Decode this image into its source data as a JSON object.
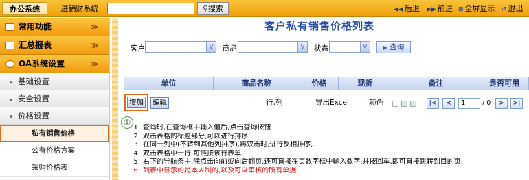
{
  "topbar": {
    "tabs": [
      "办公系统",
      "进销财系统"
    ],
    "search_value": "",
    "search_button": "搜索",
    "actions": [
      "后退",
      "前进",
      "全屏显示",
      "退出"
    ]
  },
  "sidebar": {
    "groups": [
      "常用功能",
      "汇总报表",
      "OA系统设置"
    ],
    "group_chevron": "≫",
    "items": [
      "基础设置",
      "安全设置",
      "价格设置"
    ],
    "subitems": [
      "私有销售价格",
      "公有价格方案",
      "采购价格表"
    ]
  },
  "main": {
    "title": "客户私有销售价格列表",
    "filters": {
      "customer_label": "客户",
      "product_label": "商品",
      "status_label": "状态",
      "query_button": "查询"
    },
    "table": {
      "columns": [
        "单位",
        "商品名称",
        "价格",
        "现折",
        "备注",
        "是否可用"
      ]
    },
    "toolbar": {
      "add_button": "增加",
      "edit_button": "编辑",
      "row_col_text": "行,列",
      "export_text": "导出Excel",
      "color_text": "颜色",
      "page_value": "1",
      "page_info": "/ 0"
    },
    "callout": "①",
    "notes": [
      {
        "num": "1.",
        "text": "查询时,在查询框中输入值后,点击查询按钮"
      },
      {
        "num": "2.",
        "text": "双击表格的标题部分,可以进行排序."
      },
      {
        "num": "3.",
        "text": "在同一列中(不转到其他列排序),再双击时,进行反相排序,."
      },
      {
        "num": "4.",
        "text": "双击表格中一行,可链接该行表单."
      },
      {
        "num": "5.",
        "text": "右下的导航条中,除点击向前或向后翻页,还可直接在页数字框中输入数字,并按回车,即可直接跳转到目的页."
      },
      {
        "num": "6.",
        "text": "列表中显示的是本人制的,以及可以审核的所有单据."
      }
    ]
  }
}
